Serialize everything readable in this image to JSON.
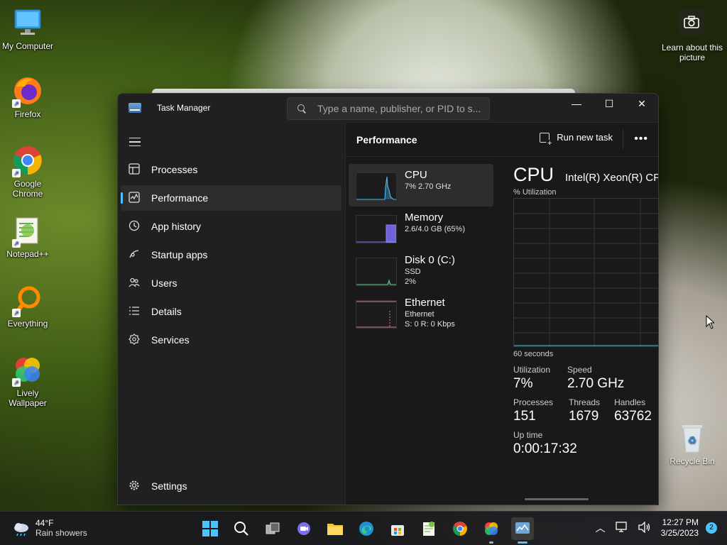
{
  "desktop": {
    "icons": [
      {
        "label": "My Computer"
      },
      {
        "label": "Firefox"
      },
      {
        "label": "Google Chrome"
      },
      {
        "label": "Notepad++"
      },
      {
        "label": "Everything"
      },
      {
        "label": "Lively Wallpaper"
      }
    ],
    "spotlight_label": "Learn about this picture",
    "recycle_bin": "Recycle Bin"
  },
  "window": {
    "title": "Task Manager",
    "search_placeholder": "Type a name, publisher, or PID to s...",
    "controls": {
      "minimize": "—",
      "maximize": "☐",
      "close": "✕"
    }
  },
  "sidebar": {
    "items": [
      {
        "label": "Processes",
        "icon": "processes-icon"
      },
      {
        "label": "Performance",
        "icon": "performance-icon",
        "active": true
      },
      {
        "label": "App history",
        "icon": "history-icon"
      },
      {
        "label": "Startup apps",
        "icon": "startup-icon"
      },
      {
        "label": "Users",
        "icon": "users-icon"
      },
      {
        "label": "Details",
        "icon": "details-icon"
      },
      {
        "label": "Services",
        "icon": "services-icon"
      }
    ],
    "settings": "Settings"
  },
  "main": {
    "heading": "Performance",
    "run_task": "Run new task",
    "more": "•••"
  },
  "tiles": [
    {
      "name": "CPU",
      "sub1": "7% 2.70 GHz",
      "sub2": "",
      "color": "#4cc2ff"
    },
    {
      "name": "Memory",
      "sub1": "2.6/4.0 GB (65%)",
      "sub2": "",
      "color": "#8a7cff"
    },
    {
      "name": "Disk 0 (C:)",
      "sub1": "SSD",
      "sub2": "2%",
      "color": "#5fd08a"
    },
    {
      "name": "Ethernet",
      "sub1": "Ethernet",
      "sub2": "S: 0 R: 0 Kbps",
      "color": "#e07aa8"
    }
  ],
  "detail": {
    "title": "CPU",
    "model": "Intel(R) Xeon(R) CPU",
    "util_label": "% Utilization",
    "axis_label": "60 seconds",
    "stats": {
      "utilization_k": "Utilization",
      "utilization_v": "7%",
      "speed_k": "Speed",
      "speed_v": "2.70 GHz",
      "processes_k": "Processes",
      "processes_v": "151",
      "threads_k": "Threads",
      "threads_v": "1679",
      "handles_k": "Handles",
      "handles_v": "63762",
      "uptime_k": "Up time",
      "uptime_v": "0:00:17:32"
    }
  },
  "taskbar": {
    "weather_temp": "44°F",
    "weather_desc": "Rain showers",
    "time": "12:27 PM",
    "date": "3/25/2023",
    "notifications": "2"
  }
}
